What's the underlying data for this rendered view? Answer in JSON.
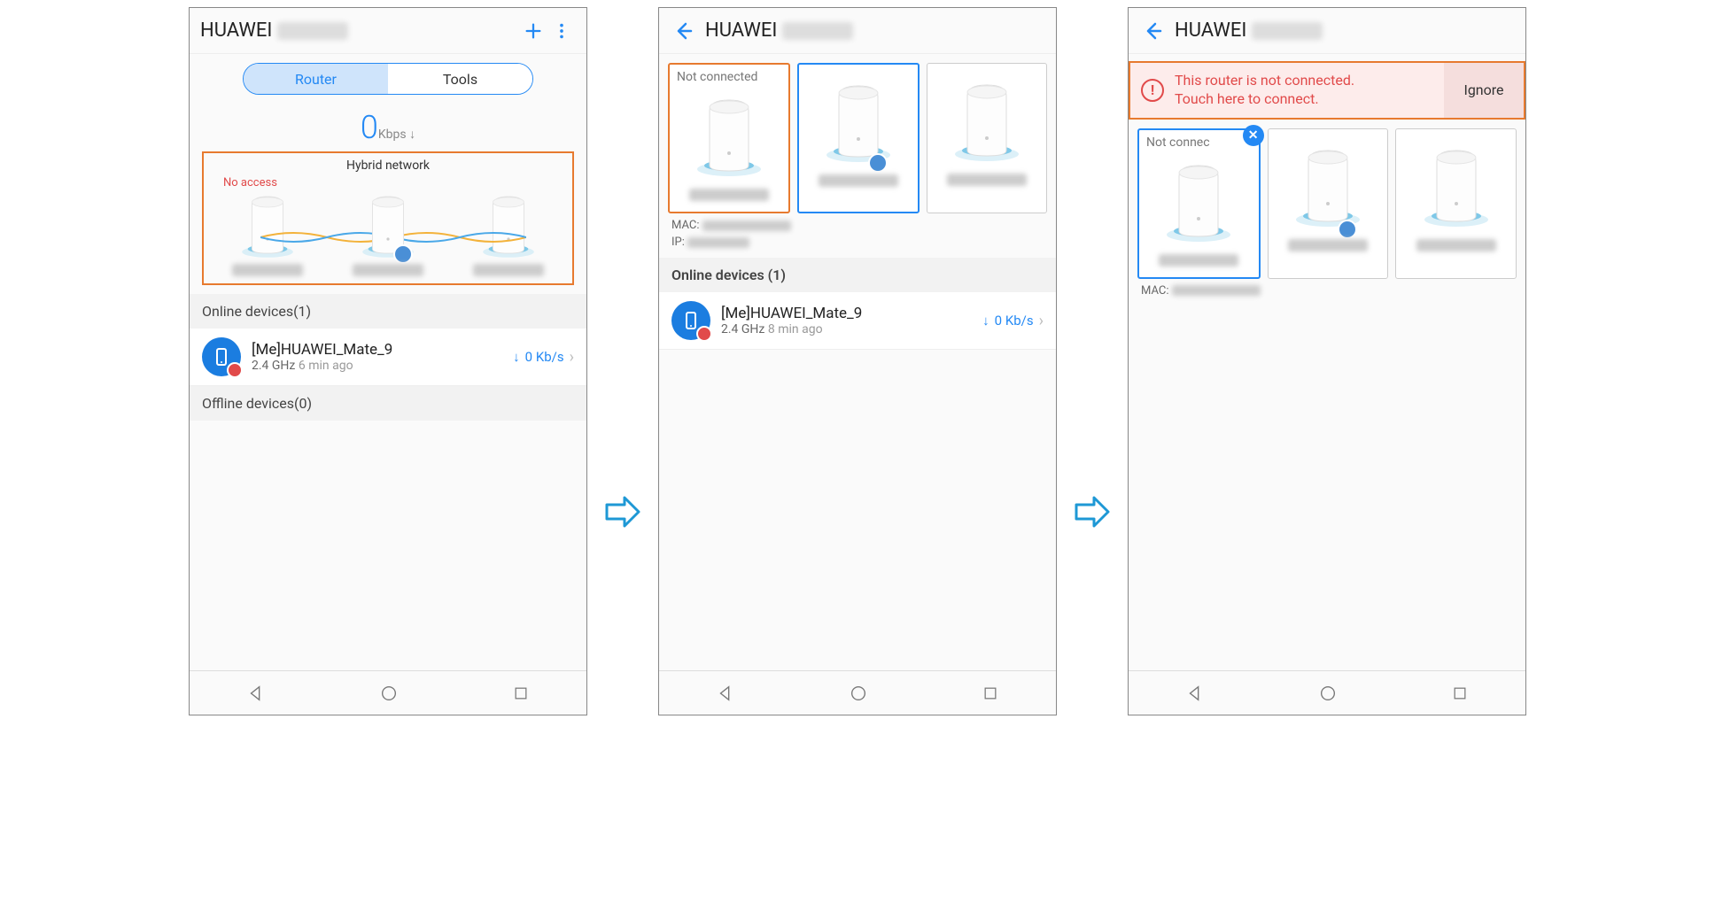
{
  "screen1": {
    "title_prefix": "HUAWEI",
    "tabs": {
      "router": "Router",
      "tools": "Tools"
    },
    "speed_value": "0",
    "speed_unit": "Kbps ↓",
    "hybrid_label": "Hybrid network",
    "no_access": "No access",
    "online_label": "Online devices(1)",
    "offline_label": "Offline devices(0)",
    "device": {
      "name": "[Me]HUAWEI_Mate_9",
      "band": "2.4 GHz",
      "ago": "6 min ago",
      "rate": "0 Kb/s"
    }
  },
  "screen2": {
    "title_prefix": "HUAWEI",
    "card1_head": "Not connected",
    "mac_label": "MAC:",
    "ip_label": "IP:",
    "online_label": "Online devices (1)",
    "device": {
      "name": "[Me]HUAWEI_Mate_9",
      "band": "2.4 GHz",
      "ago": "8 min ago",
      "rate": "0 Kb/s"
    }
  },
  "screen3": {
    "title_prefix": "HUAWEI",
    "alert_line1": "This router is not connected.",
    "alert_line2": "Touch here to connect.",
    "ignore": "Ignore",
    "card1_head": "Not connec",
    "mac_label": "MAC:"
  }
}
